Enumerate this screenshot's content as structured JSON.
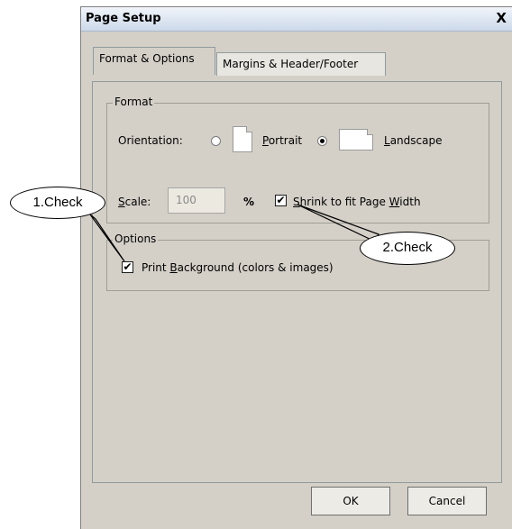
{
  "dialog": {
    "title": "Page Setup",
    "close_label": "X"
  },
  "tabs": [
    {
      "label": "Format & Options",
      "active": true
    },
    {
      "label": "Margins & Header/Footer",
      "active": false
    }
  ],
  "format": {
    "group_label": "Format",
    "orientation_label": "Orientation:",
    "portrait_label": "Portrait",
    "landscape_label": "Landscape",
    "selected_orientation": "Landscape",
    "scale_label": "Scale:",
    "scale_value": "100",
    "percent_label": "%",
    "shrink_label": "Shrink to fit Page Width",
    "shrink_checked": true
  },
  "options": {
    "group_label": "Options",
    "print_bg_label": "Print Background (colors & images)",
    "print_bg_checked": true
  },
  "buttons": {
    "ok": "OK",
    "cancel": "Cancel"
  },
  "annotations": {
    "callout1": "1.Check",
    "callout2": "2.Check"
  },
  "checkmark_glyph": "✔"
}
